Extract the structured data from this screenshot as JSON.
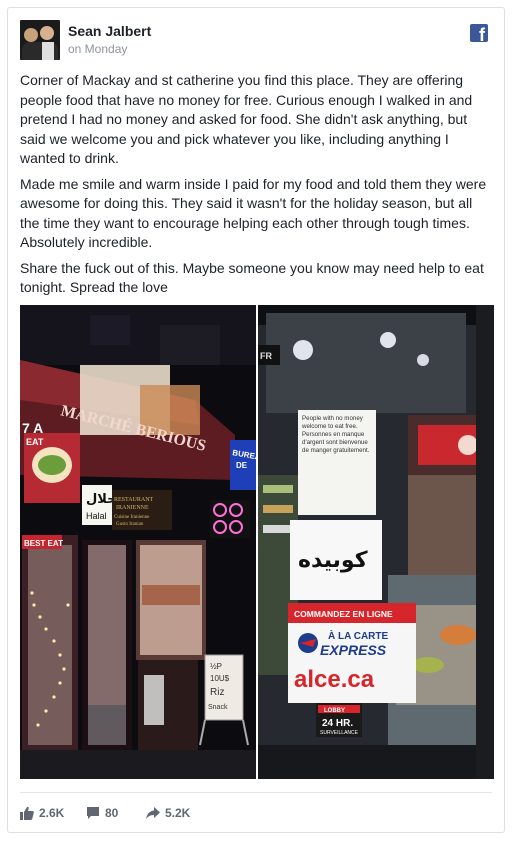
{
  "post": {
    "author": "Sean Jalbert",
    "timestamp": "on Monday",
    "paragraphs": [
      "Corner of Mackay and st catherine you find this place. They are offering people food that have no money for free. Curious enough I walked in and pretend I had no money and asked for food. She didn't ask anything, but said we welcome you and pick whatever you like, including anything I wanted to drink.",
      "Made me smile and warm inside I paid for my food and told them they were awesome for doing this. They said it wasn't for the holiday season, but all the time they want to encourage helping each other through tough times. Absolutely incredible.",
      "Share the fuck out of this. Maybe someone you know may need help to eat tonight. Spread the love"
    ]
  },
  "photo_left": {
    "sign_main": "MARCHÉ BERIOUS",
    "sign_7": "7 A",
    "sign_eat": "EAT",
    "halal_text": "Halal",
    "restaurant_line1": "RESTAURANT",
    "restaurant_line2": "IRANIENNE",
    "restaurant_line3": "Cuisine Iranienne",
    "restaurant_line4": "Gusto Iranian",
    "bureau_text": "BUREAU",
    "bureau_text2": "DE",
    "best_eat": "BEST EAT",
    "board_line1": "½P",
    "board_line2": "10U$",
    "board_line3": "Riz",
    "board_line4": "Snack"
  },
  "photo_right": {
    "notice_en": "People with no money welcome to eat free.",
    "notice_fr": "Personnes en manque d'argent sont bienvenue de manger gratuitement.",
    "arabic_sign": "كوبيده",
    "commandez": "COMMANDEZ EN LIGNE",
    "a_la_carte": "À LA CARTE",
    "express": "EXPRESS",
    "alce": "alce.ca",
    "lobby": "LOBBY",
    "hours": "24 HR.",
    "surveillance": "SURVEILLANCE",
    "top_sign": "FR"
  },
  "reactions": {
    "likes": "2.6K",
    "comments": "80",
    "shares": "5.2K"
  },
  "colors": {
    "facebook_blue": "#3b5998",
    "meta_gray": "#90949c",
    "action_gray": "#616770"
  },
  "icons": {
    "brand": "facebook-icon",
    "like": "thumbs-up-icon",
    "comment": "speech-bubble-icon",
    "share": "share-arrow-icon"
  }
}
